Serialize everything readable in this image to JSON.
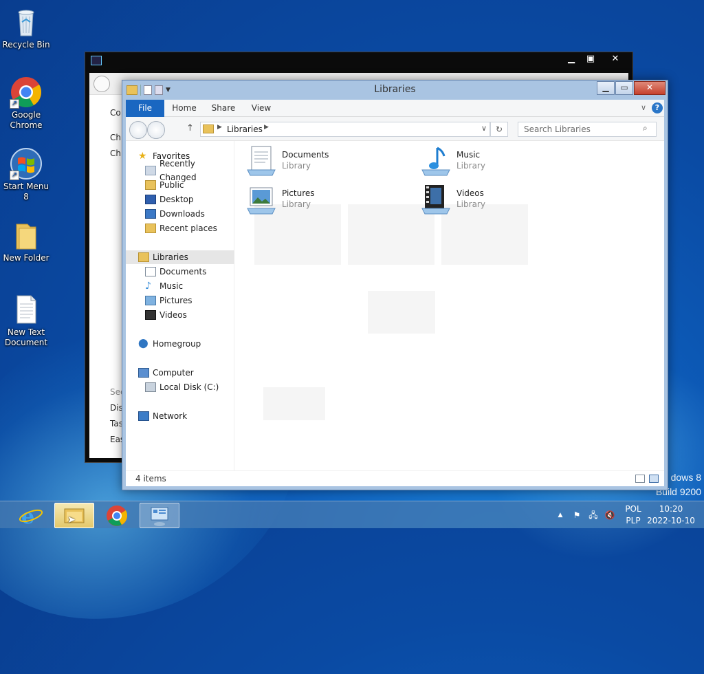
{
  "desktop": {
    "icons": [
      {
        "label": "Recycle Bin"
      },
      {
        "label": "Google Chrome"
      },
      {
        "label": "Start Menu 8"
      },
      {
        "label": "New Folder"
      },
      {
        "label": "New Text Document"
      }
    ],
    "watermark": {
      "line1": "dows 8",
      "line2": "Build 9200"
    }
  },
  "back_window": {
    "labels": [
      "Co",
      "Ch",
      "Ch",
      "See",
      "Dis",
      "Tas",
      "Eas"
    ]
  },
  "explorer": {
    "title": "Libraries",
    "ribbon_tabs": [
      "File",
      "Home",
      "Share",
      "View"
    ],
    "breadcrumb": "Libraries",
    "search_placeholder": "Search Libraries",
    "nav": {
      "favorites": "Favorites",
      "favorites_items": [
        "Recently Changed",
        "Public",
        "Desktop",
        "Downloads",
        "Recent places"
      ],
      "libraries": "Libraries",
      "libraries_items": [
        "Documents",
        "Music",
        "Pictures",
        "Videos"
      ],
      "homegroup": "Homegroup",
      "computer": "Computer",
      "computer_items": [
        "Local Disk (C:)"
      ],
      "network": "Network"
    },
    "items": [
      {
        "name": "Documents",
        "type": "Library"
      },
      {
        "name": "Music",
        "type": "Library"
      },
      {
        "name": "Pictures",
        "type": "Library"
      },
      {
        "name": "Videos",
        "type": "Library"
      }
    ],
    "status": "4 items"
  },
  "taskbar": {
    "lang_top": "POL",
    "lang_bottom": "PLP",
    "time": "10:20",
    "date": "2022-10-10"
  }
}
